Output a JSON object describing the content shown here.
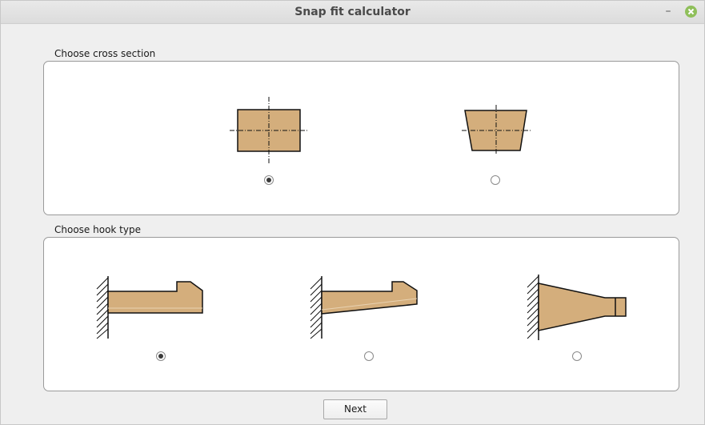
{
  "window": {
    "title": "Snap fit calculator"
  },
  "titlebar": {
    "minimize_glyph": "–",
    "close_icon": "close-icon"
  },
  "cross_section": {
    "label": "Choose cross section",
    "options": [
      {
        "icon": "rectangle-section-icon",
        "selected": true
      },
      {
        "icon": "trapezoid-section-icon",
        "selected": false
      }
    ]
  },
  "hook_type": {
    "label": "Choose hook type",
    "options": [
      {
        "icon": "straight-hook-icon",
        "selected": true
      },
      {
        "icon": "tapered-thickness-hook-icon",
        "selected": false
      },
      {
        "icon": "tapered-width-hook-icon",
        "selected": false
      }
    ]
  },
  "footer": {
    "next_label": "Next"
  },
  "colors": {
    "fill": "#d4ae7c",
    "stroke": "#111111",
    "close_button": "#8fbf5a"
  }
}
